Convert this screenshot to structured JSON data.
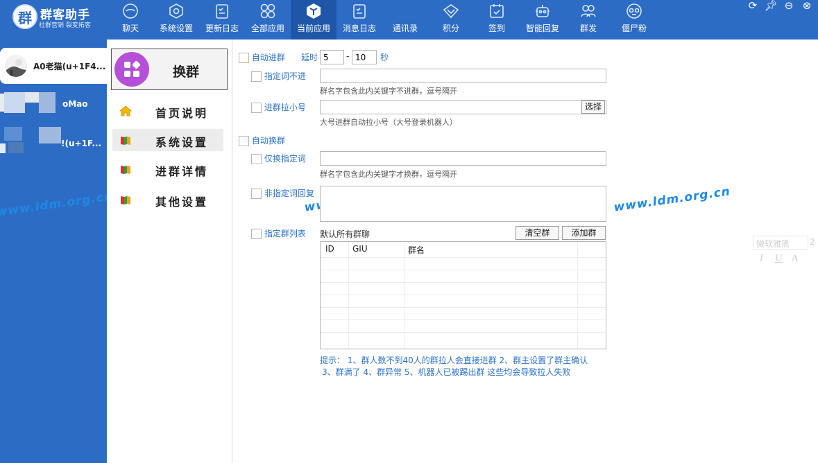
{
  "app": {
    "logo_char": "群",
    "title": "群客助手",
    "subtitle": "社群营销 裂变拓客"
  },
  "nav": [
    {
      "label": "聊天",
      "icon": "chat-icon"
    },
    {
      "label": "系统设置",
      "icon": "settings-icon"
    },
    {
      "label": "更新日志",
      "icon": "clipboard-icon"
    },
    {
      "label": "全部应用",
      "icon": "apps-icon"
    },
    {
      "label": "当前应用",
      "icon": "cube-icon",
      "active": true
    },
    {
      "label": "消息日志",
      "icon": "log-icon"
    },
    {
      "label": "通讯录",
      "icon": "contacts-icon"
    },
    {
      "label": "积分",
      "icon": "points-icon"
    },
    {
      "label": "签到",
      "icon": "checkin-icon"
    },
    {
      "label": "智能回复",
      "icon": "robot-icon"
    },
    {
      "label": "群发",
      "icon": "group-send-icon"
    },
    {
      "label": "僵尸粉",
      "icon": "zombie-icon"
    }
  ],
  "accounts": [
    {
      "name": "A0老猫(u+1F4..."
    },
    {
      "name": "oMao"
    },
    {
      "name": "!(u+1F..."
    }
  ],
  "watermark": "www.ldm.org.cn",
  "menu": {
    "main_button": "换群",
    "items": [
      {
        "label": "首页说明",
        "icon": "home-icon"
      },
      {
        "label": "系统设置",
        "icon": "book-icon",
        "active": true
      },
      {
        "label": "进群详情",
        "icon": "book-icon"
      },
      {
        "label": "其他设置",
        "icon": "book-icon"
      }
    ]
  },
  "form": {
    "auto_join": "自动进群",
    "delay_label": "延时",
    "delay_min": "5",
    "delay_sep": "-",
    "delay_max": "10",
    "delay_unit": "秒",
    "keyword_block": "指定词不进",
    "keyword_block_hint": "群名字包含此内关键字不进群，逗号隔开",
    "pull_small": "进群拉小号",
    "select_button": "选择",
    "pull_small_hint": "大号进群自动拉小号（大号登录机器人）",
    "auto_switch": "自动换群",
    "only_keyword": "仅换指定词",
    "only_keyword_hint": "群名字包含此内关键字才换群，逗号隔开",
    "non_keyword_reply": "非指定词回复",
    "group_list": "指定群列表",
    "group_list_default": "默认所有群聊",
    "clear_button": "清空群",
    "add_button": "添加群",
    "columns": [
      "ID",
      "GIU",
      "群名"
    ],
    "tip_line1": "提示：  1、群人数不到40人的群拉人会直接进群 2、群主设置了群主确认",
    "tip_line2": "3、群满了  4、群异常 5、机器人已被踢出群  这些均会导致拉人失败"
  },
  "ghost_toolbar": {
    "font": "微软雅黑",
    "size": "2",
    "italic": "I",
    "underline": "U",
    "color": "A"
  }
}
